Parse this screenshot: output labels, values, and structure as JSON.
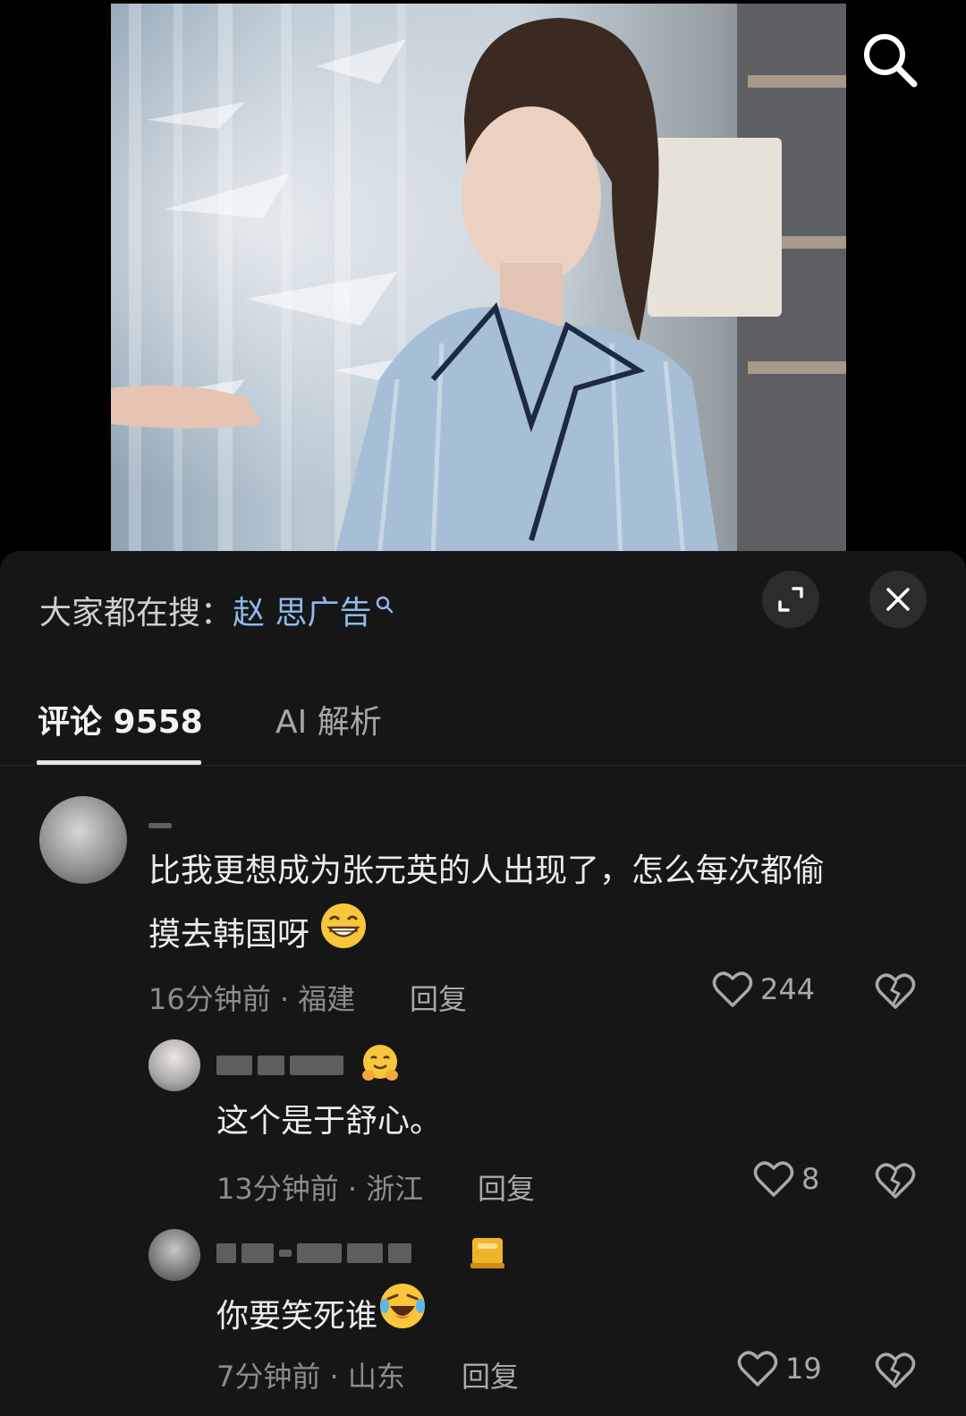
{
  "trending": {
    "prefix": "大家都在搜：",
    "keyword": "赵 思广告"
  },
  "tabs": {
    "comments_label": "评论 9558",
    "ai_label": "AI 解析"
  },
  "comments": [
    {
      "text_line1": "比我更想成为张元英的人出现了，怎么每次都偷",
      "text_line2": "摸去韩国呀",
      "emoji": "grin-face-icon",
      "time_location": "16分钟前 · 福建",
      "reply": "回复",
      "likes": "244"
    },
    {
      "user_emoji": "hug-face-icon",
      "text": "这个是于舒心。",
      "time_location": "13分钟前 · 浙江",
      "reply": "回复",
      "likes": "8"
    },
    {
      "user_emoji": "badge-icon",
      "text": "你要笑死谁",
      "emoji": "rofl-face-icon",
      "time_location": "7分钟前 · 山东",
      "reply": "回复",
      "likes": "19"
    }
  ],
  "colors": {
    "sheet_bg": "#161616",
    "keyword": "#8fb9ec",
    "text": "#ececec",
    "muted": "#8c8c8c"
  }
}
